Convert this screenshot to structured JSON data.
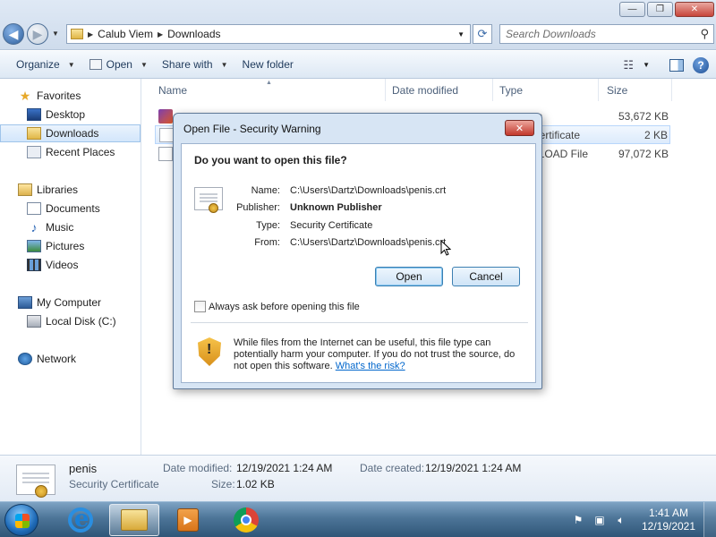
{
  "window": {
    "controls": {
      "minimize": "—",
      "maximize": "❐",
      "close": "✕"
    }
  },
  "address": {
    "crumbs": [
      "Calub Viem",
      "Downloads"
    ],
    "search_placeholder": "Search Downloads"
  },
  "toolbar": {
    "organize": "Organize",
    "open": "Open",
    "share_with": "Share with",
    "new_folder": "New folder"
  },
  "nav": {
    "favorites": "Favorites",
    "desktop": "Desktop",
    "downloads": "Downloads",
    "recent_places": "Recent Places",
    "libraries": "Libraries",
    "documents": "Documents",
    "music": "Music",
    "pictures": "Pictures",
    "videos": "Videos",
    "my_computer": "My Computer",
    "local_disk": "Local Disk (C:)",
    "network": "Network"
  },
  "filelist": {
    "columns": {
      "name": "Name",
      "date_modified": "Date modified",
      "type": "Type",
      "size": "Size"
    },
    "rows": [
      {
        "type_fragment": "on",
        "size": "53,672 KB"
      },
      {
        "type_fragment": "Certificate",
        "size": "2 KB"
      },
      {
        "type_fragment": "NLOAD File",
        "size": "97,072 KB"
      }
    ]
  },
  "details": {
    "name": "penis",
    "type": "Security Certificate",
    "date_modified_label": "Date modified:",
    "date_modified": "12/19/2021 1:24 AM",
    "date_created_label": "Date created:",
    "date_created": "12/19/2021 1:24 AM",
    "size_label": "Size:",
    "size": "1.02 KB"
  },
  "dialog": {
    "title": "Open File - Security Warning",
    "close": "✕",
    "question": "Do you want to open this file?",
    "name_label": "Name:",
    "name_value": "C:\\Users\\Dartz\\Downloads\\penis.crt",
    "publisher_label": "Publisher:",
    "publisher_value": "Unknown Publisher",
    "type_label": "Type:",
    "type_value": "Security Certificate",
    "from_label": "From:",
    "from_value": "C:\\Users\\Dartz\\Downloads\\penis.crt",
    "open_button": "Open",
    "cancel_button": "Cancel",
    "checkbox_label": "Always ask before opening this file",
    "warning_text": "While files from the Internet can be useful, this file type can potentially harm your computer. If you do not trust the source, do not open this software.",
    "warning_link": "What's the risk?"
  },
  "taskbar": {
    "time": "1:41 AM",
    "date": "12/19/2021"
  }
}
